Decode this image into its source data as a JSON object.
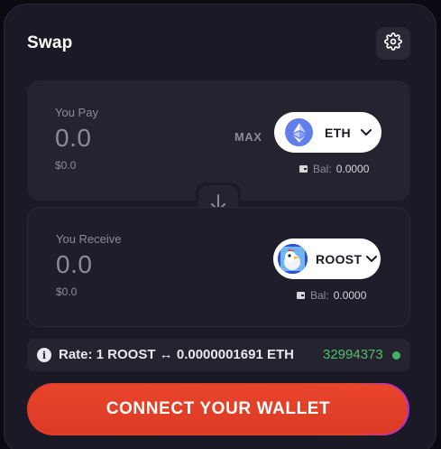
{
  "header": {
    "title": "Swap"
  },
  "pay": {
    "label": "You Pay",
    "amount": "0.0",
    "usd": "$0.0",
    "max_label": "MAX",
    "token": "ETH",
    "balance_label": "Bal:",
    "balance_value": "0.0000"
  },
  "receive": {
    "label": "You Receive",
    "amount": "0.0",
    "usd": "$0.0",
    "token": "ROOST",
    "balance_label": "Bal:",
    "balance_value": "0.0000"
  },
  "rate": {
    "text": "Rate: 1 ROOST ↔ 0.0000001691 ETH",
    "block_number": "32994373",
    "status_color": "#3fb35f"
  },
  "connect": {
    "label": "CONNECT YOUR WALLET"
  },
  "icons": {
    "settings": "gear-icon",
    "eth": "ethereum-icon",
    "roost": "roost-token-icon",
    "swap_direction": "arrow-down-icon",
    "info": "info-icon",
    "wallet": "wallet-icon",
    "chevron": "chevron-down-icon"
  },
  "colors": {
    "accent": "#e33f24",
    "accent_edge": "#b02fd6",
    "status_green": "#4fc06c"
  }
}
